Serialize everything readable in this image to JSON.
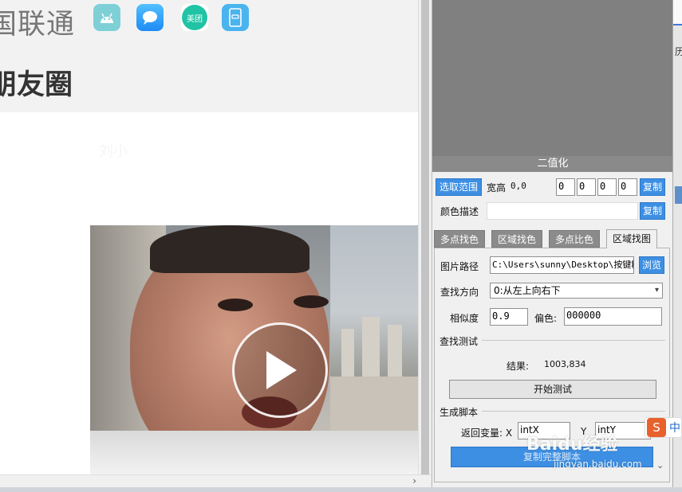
{
  "phone": {
    "app_name": "国联通",
    "apps": [
      "android-app-icon",
      "messages-app-icon",
      "meituan-app-icon",
      "card-app-icon"
    ],
    "meituan_label": "美团",
    "moments_title": "朋友圈",
    "faded_name": "刘小"
  },
  "panel": {
    "title": "二值化",
    "select_range_label": "选取范围",
    "size_label": "宽高",
    "size_value": "0,0",
    "coords": [
      "0",
      "0",
      "0",
      "0"
    ],
    "copy_label": "复制",
    "color_desc_label": "颜色描述",
    "color_desc_value": "",
    "copy2_label": "复制",
    "tabs": [
      "多点找色",
      "区域找色",
      "多点比色",
      "区域找图"
    ],
    "active_tab": 3,
    "image_path_label": "图片路径",
    "image_path_value": "C:\\Users\\sunny\\Desktop\\按键精",
    "browse_label": "浏览",
    "direction_label": "查找方向",
    "direction_value": "0:从左上向右下",
    "similarity_label": "相似度",
    "similarity_value": "0.9",
    "offset_label": "偏色:",
    "offset_value": "000000",
    "test_section": "查找测试",
    "result_label": "结果:",
    "result_value": "1003,834",
    "start_test_label": "开始测试",
    "script_section": "生成脚本",
    "return_var_label": "返回变量: X",
    "var_x": "intX",
    "y_label": "Y",
    "var_y": "intY",
    "copy_script_label": "复制完整脚本"
  },
  "right_edge": {
    "text": "历"
  },
  "ime": {
    "icon": "S",
    "lang": "中"
  },
  "watermark": {
    "brand": "Baidu经验",
    "url": "jingyan.baidu.com"
  },
  "colors": {
    "accent": "#3d8fe3",
    "tab_gray": "#8b8b8b",
    "preview_gray": "#808080"
  }
}
